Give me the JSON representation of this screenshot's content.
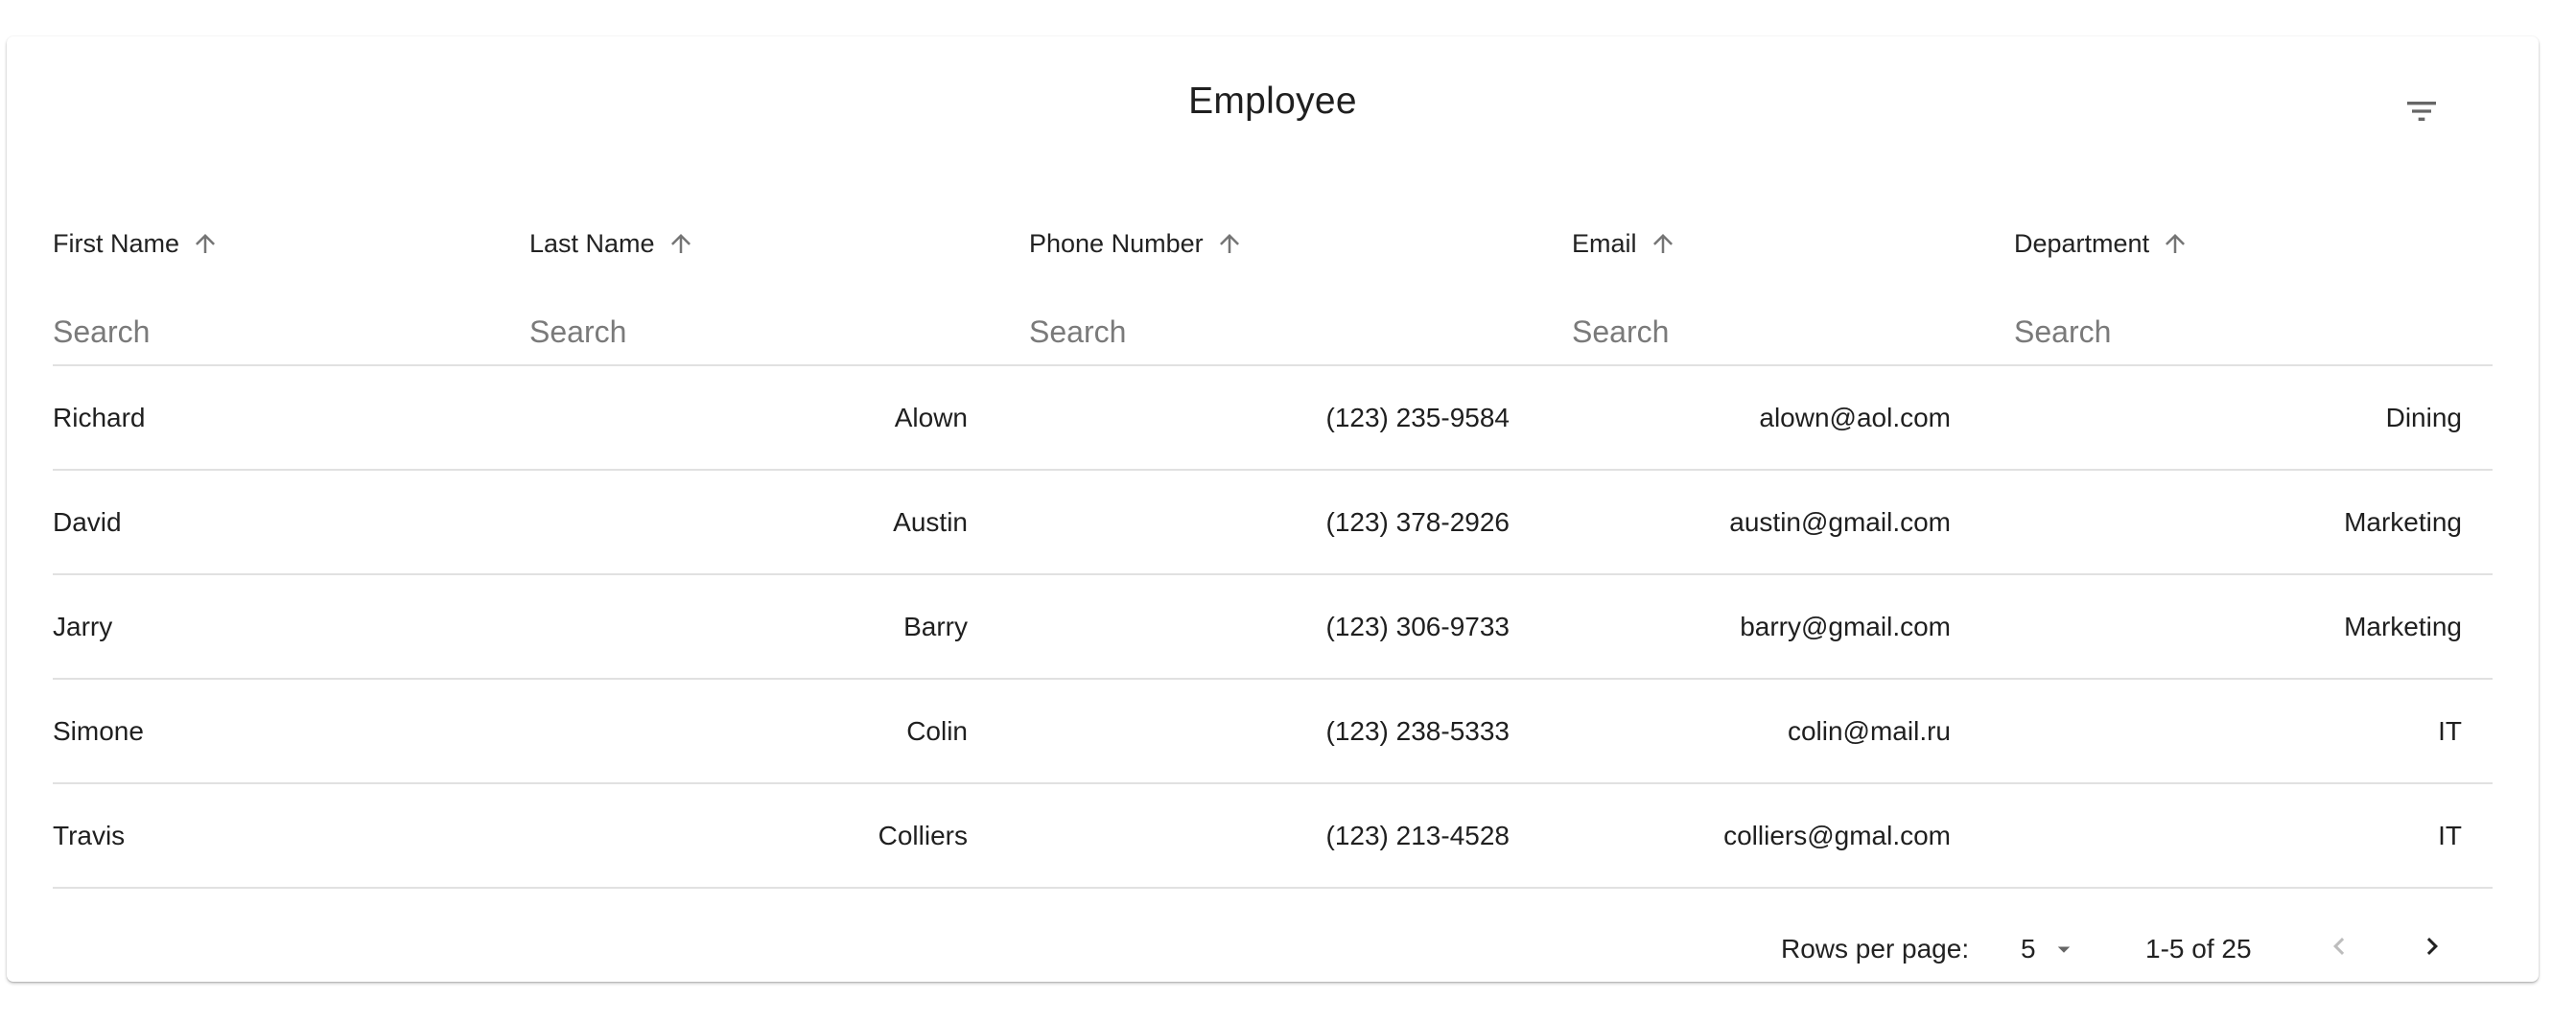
{
  "table": {
    "title": "Employee",
    "filter_icon": "filter-list-icon",
    "columns": [
      {
        "label": "First Name",
        "sort_icon": "arrow-up-icon",
        "placeholder": "Search"
      },
      {
        "label": "Last Name",
        "sort_icon": "arrow-up-icon",
        "placeholder": "Search"
      },
      {
        "label": "Phone Number",
        "sort_icon": "arrow-up-icon",
        "placeholder": "Search"
      },
      {
        "label": "Email",
        "sort_icon": "arrow-up-icon",
        "placeholder": "Search"
      },
      {
        "label": "Department",
        "sort_icon": "arrow-up-icon",
        "placeholder": "Search"
      }
    ],
    "rows": [
      [
        "Richard",
        "Alown",
        "(123) 235-9584",
        "alown@aol.com",
        "Dining"
      ],
      [
        "David",
        "Austin",
        "(123) 378-2926",
        "austin@gmail.com",
        "Marketing"
      ],
      [
        "Jarry",
        "Barry",
        "(123) 306-9733",
        "barry@gmail.com",
        "Marketing"
      ],
      [
        "Simone",
        "Colin",
        "(123) 238-5333",
        "colin@mail.ru",
        "IT"
      ],
      [
        "Travis",
        "Colliers",
        "(123) 213-4528",
        "colliers@gmal.com",
        "IT"
      ]
    ]
  },
  "pagination": {
    "rows_per_page_label": "Rows per page:",
    "rows_per_page_value": "5",
    "range": "1-5 of 25",
    "prev_icon": "chevron-left-icon",
    "next_icon": "chevron-right-icon"
  },
  "colors": {
    "text": "#1f1f1f",
    "icon": "#757575",
    "divider": "#e1e1e1",
    "disabled": "#bdbdbd"
  }
}
